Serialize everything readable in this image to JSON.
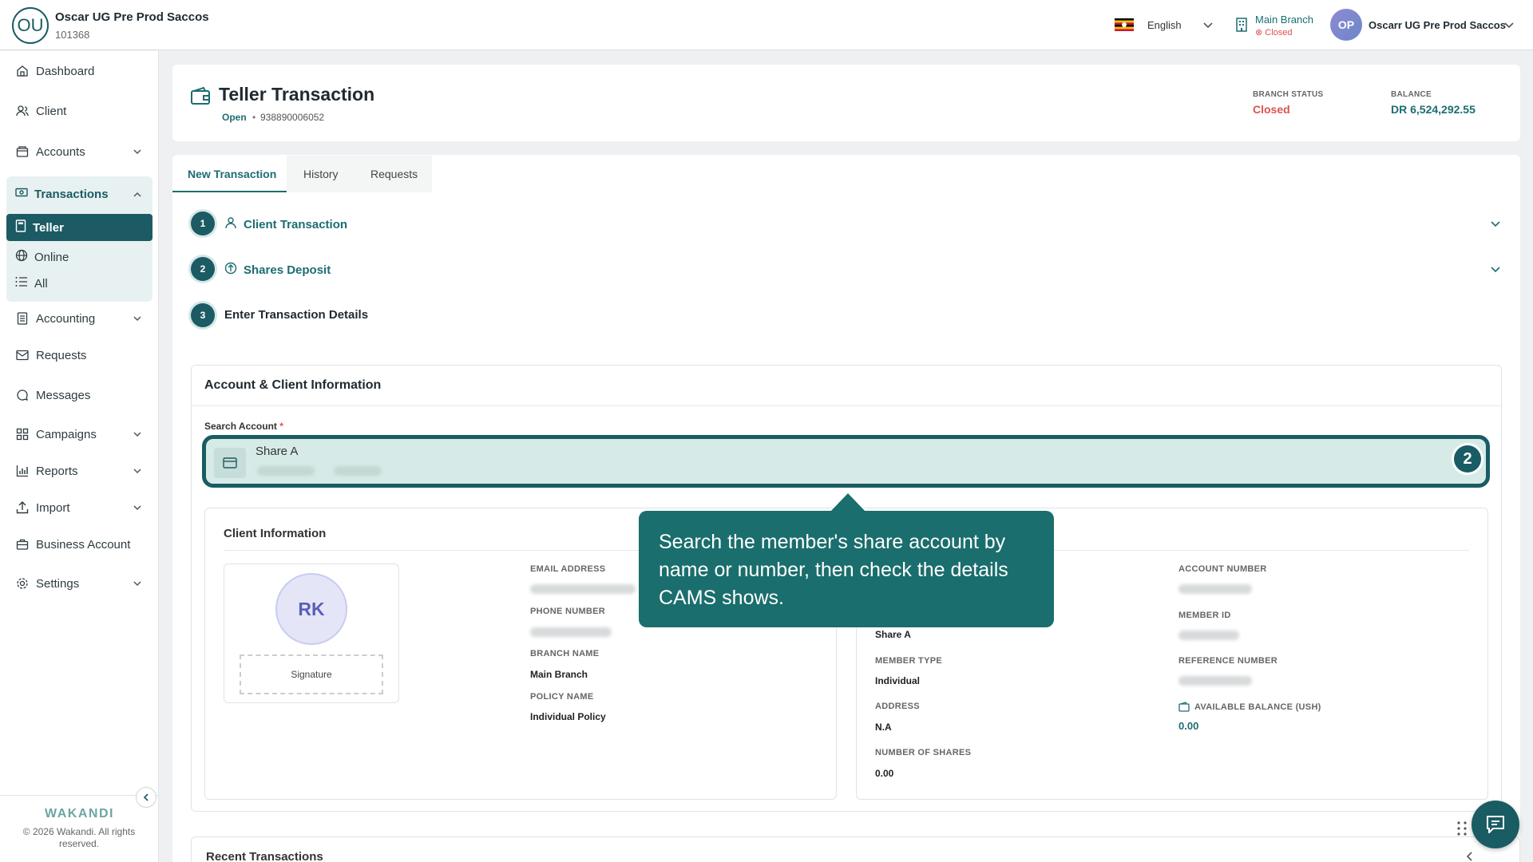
{
  "org": {
    "initials": "OU",
    "name": "Oscar UG Pre Prod Saccos",
    "id": "101368"
  },
  "topbar": {
    "language": "English",
    "branch_name": "Main Branch",
    "branch_status": "Closed",
    "user_initials": "OP",
    "user_name": "Oscarr UG Pre Prod Saccos"
  },
  "sidebar": {
    "dashboard": "Dashboard",
    "client": "Client",
    "accounts": "Accounts",
    "transactions": "Transactions",
    "teller": "Teller",
    "online": "Online",
    "all": "All",
    "accounting": "Accounting",
    "requests": "Requests",
    "messages": "Messages",
    "campaigns": "Campaigns",
    "reports": "Reports",
    "import": "Import",
    "business_account": "Business Account",
    "settings": "Settings",
    "brand": "WAKANDI",
    "copyright": "© 2026 Wakandi. All rights reserved."
  },
  "header": {
    "title": "Teller Transaction",
    "state": "Open",
    "dot": "•",
    "account": "938890006052",
    "branch_status_label": "BRANCH STATUS",
    "branch_status_value": "Closed",
    "balance_label": "BALANCE",
    "balance_value": "DR 6,524,292.55"
  },
  "tabs": [
    "New Transaction",
    "History",
    "Requests"
  ],
  "steps": [
    {
      "num": "1",
      "label": "Client Transaction"
    },
    {
      "num": "2",
      "label": "Shares Deposit"
    },
    {
      "num": "3",
      "label": "Enter Transaction Details"
    }
  ],
  "account_panel": {
    "title": "Account & Client Information",
    "search_label": "Search Account",
    "required": "*",
    "search_value": "Share A",
    "badge": "2"
  },
  "client_info": {
    "title": "Client Information",
    "initials": "RK",
    "signature": "Signature",
    "email_label": "EMAIL ADDRESS",
    "phone_label": "PHONE NUMBER",
    "branch_label": "BRANCH NAME",
    "branch_value": "Main Branch",
    "policy_label": "POLICY NAME",
    "policy_value": "Individual Policy",
    "product_value": "Share A",
    "member_type_label": "MEMBER TYPE",
    "member_type_value": "Individual",
    "address_label": "ADDRESS",
    "address_value": "N.A",
    "shares_label": "NUMBER OF SHARES",
    "shares_value": "0.00",
    "account_number_label": "ACCOUNT NUMBER",
    "member_id_label": "MEMBER ID",
    "reference_label": "REFERENCE NUMBER",
    "available_label": "AVAILABLE BALANCE (USH)",
    "available_value": "0.00"
  },
  "tooltip": {
    "text": "Search the member's share account by name or number, then check the details CAMS shows."
  },
  "recent": {
    "title": "Recent Transactions"
  },
  "colors": {
    "primary": "#1c5b63",
    "accent": "#1c6d72",
    "danger": "#d9534f",
    "tooltip": "#1a6e6d"
  }
}
